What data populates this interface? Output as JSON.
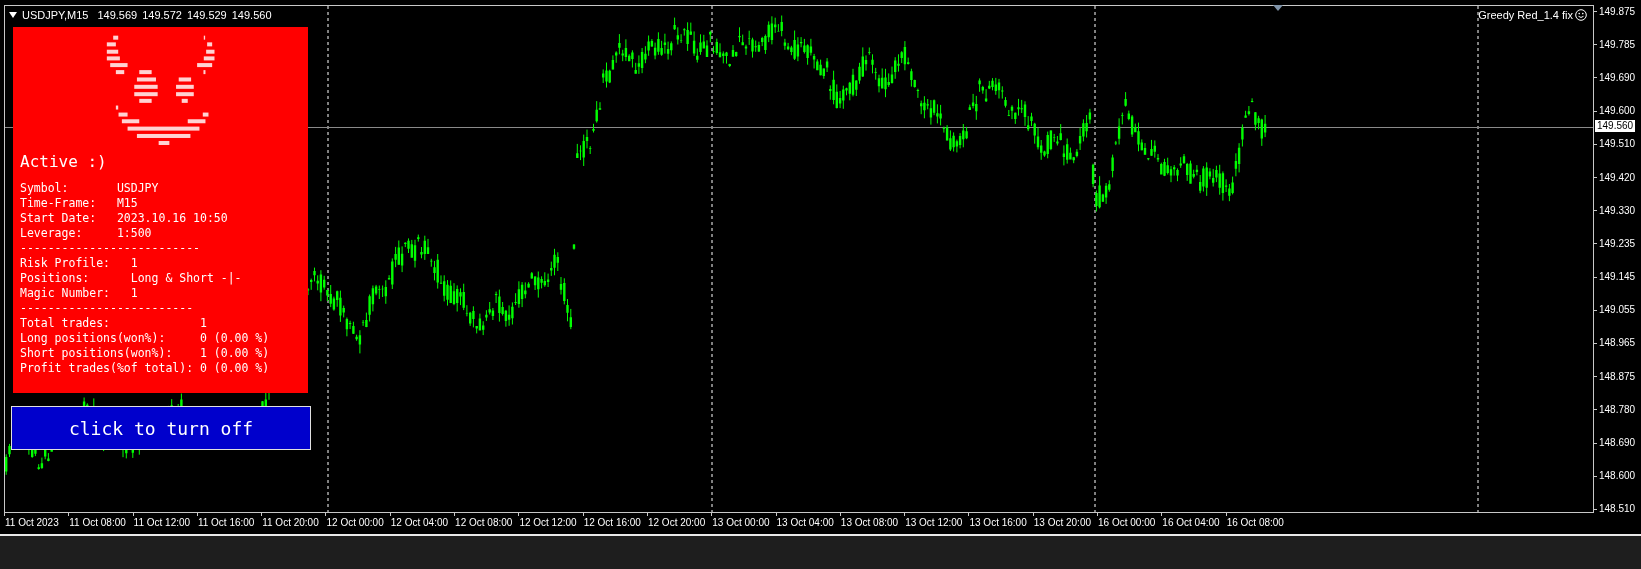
{
  "chart": {
    "header": {
      "symbol": "USDJPY,M15",
      "quotes": [
        "149.569",
        "149.572",
        "149.529",
        "149.560"
      ]
    },
    "indicator_name": "Greedy Red_1.4 fix",
    "current_price": "149.560",
    "price_axis": [
      "149.875",
      "149.785",
      "149.690",
      "149.600",
      "149.510",
      "149.420",
      "149.330",
      "149.235",
      "149.145",
      "149.055",
      "148.965",
      "148.875",
      "148.780",
      "148.690",
      "148.600",
      "148.510"
    ],
    "time_axis": [
      "11 Oct 2023",
      "11 Oct 08:00",
      "11 Oct 12:00",
      "11 Oct 16:00",
      "11 Oct 20:00",
      "12 Oct 00:00",
      "12 Oct 04:00",
      "12 Oct 08:00",
      "12 Oct 12:00",
      "12 Oct 16:00",
      "12 Oct 20:00",
      "13 Oct 00:00",
      "13 Oct 04:00",
      "13 Oct 08:00",
      "13 Oct 12:00",
      "13 Oct 16:00",
      "13 Oct 20:00",
      "16 Oct 00:00",
      "16 Oct 04:00",
      "16 Oct 08:00"
    ]
  },
  "ea_panel": {
    "status": "Active :)",
    "sections": [
      {
        "kind": "rows",
        "rows": [
          {
            "label": "Symbol:",
            "value": "USDJPY"
          },
          {
            "label": "Time-Frame:",
            "value": "M15"
          },
          {
            "label": "Start Date:",
            "value": "2023.10.16 10:50"
          },
          {
            "label": "Leverage:",
            "value": "1:500"
          }
        ]
      },
      {
        "kind": "separator",
        "text": "--------------------------"
      },
      {
        "kind": "rows",
        "rows": [
          {
            "label": "Risk Profile:",
            "value": "1"
          },
          {
            "label": "Positions:",
            "value": "Long & Short -|-"
          },
          {
            "label": "Magic Number:",
            "value": "1"
          }
        ]
      },
      {
        "kind": "separator",
        "text": "-------------------------"
      },
      {
        "kind": "rows",
        "rows": [
          {
            "label": "Total trades:",
            "value": "1"
          },
          {
            "label": "Long positions(won%):",
            "value": "0 (0.00 %)"
          },
          {
            "label": "Short positions(won%):",
            "value": "1 (0.00 %)"
          },
          {
            "label": "Profit trades(%of total):",
            "value": "0 (0.00 %)"
          }
        ]
      }
    ],
    "button": {
      "label": "click to turn off"
    }
  }
}
